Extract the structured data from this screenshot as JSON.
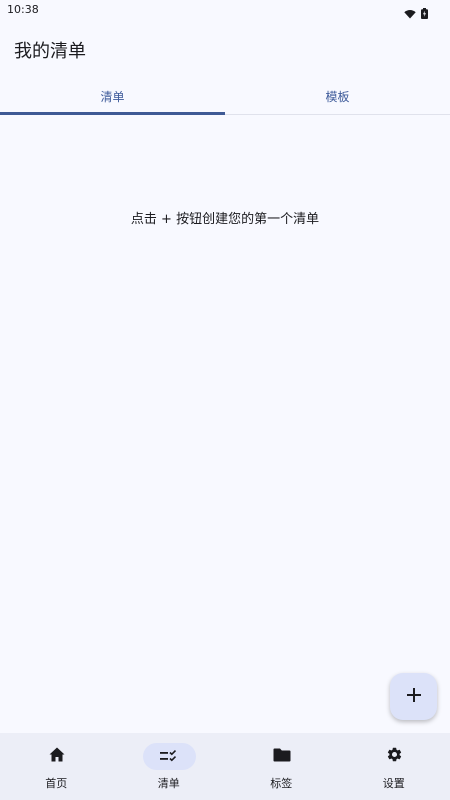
{
  "status_bar": {
    "time": "10:38",
    "icons": [
      "wifi-icon",
      "battery-icon"
    ]
  },
  "app_bar": {
    "title": "我的清单"
  },
  "tabs": [
    {
      "label": "清单",
      "active": true
    },
    {
      "label": "模板",
      "active": false
    }
  ],
  "empty_state": {
    "message": "点击 + 按钮创建您的第一个清单"
  },
  "fab": {
    "icon": "plus-icon"
  },
  "bottom_nav": {
    "items": [
      {
        "label": "首页",
        "icon": "home-icon",
        "active": false
      },
      {
        "label": "清单",
        "icon": "checklist-icon",
        "active": true
      },
      {
        "label": "标签",
        "icon": "folder-icon",
        "active": false
      },
      {
        "label": "设置",
        "icon": "gear-icon",
        "active": false
      }
    ]
  },
  "colors": {
    "background": "#f8f9ff",
    "accent": "#3f5a95",
    "active_container": "#dce2f9",
    "nav_background": "#eceef7",
    "text": "#1b1b1f"
  }
}
